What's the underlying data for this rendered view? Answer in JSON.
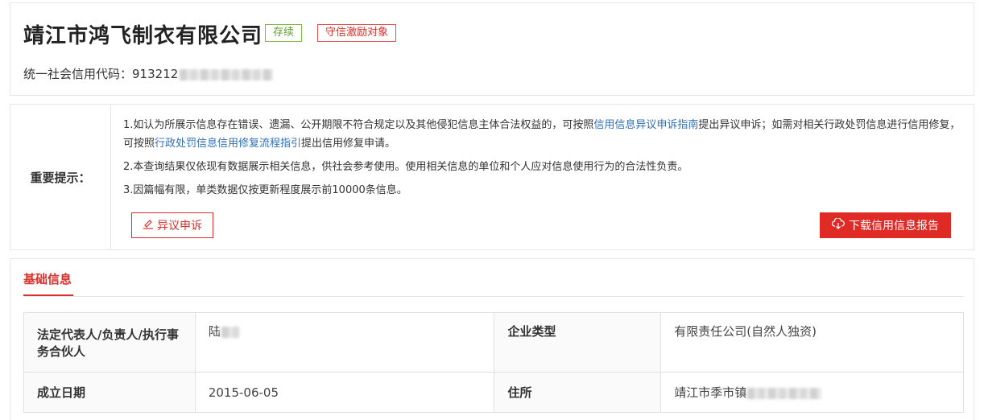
{
  "header": {
    "company_name": "靖江市鸿飞制衣有限公司",
    "status_badge": "存续",
    "honor_badge": "守信激励对象",
    "credit_code_label": "统一社会信用代码：",
    "credit_code_value": "913212"
  },
  "notice": {
    "label": "重要提示：",
    "line1_part1": "1.如认为所展示信息存在错误、遗漏、公开期限不符合规定以及其他侵犯信息主体合法权益的，可按照",
    "line1_link1": "信用信息异议申诉指南",
    "line1_part2": "提出异议申诉；如需对相关行政处罚信息进行信用修复，可按照",
    "line1_link2": "行政处罚信息信用修复流程指引",
    "line1_part3": "提出信用修复申请。",
    "line2": "2.本查询结果仅依现有数据展示相关信息，供社会参考使用。使用相关信息的单位和个人应对信息使用行为的合法性负责。",
    "line3": "3.因篇幅有限，单类数据仅按更新程度展示前10000条信息。",
    "objection_button": "异议申诉",
    "download_button": "下载信用信息报告"
  },
  "basic_info": {
    "tab_label": "基础信息",
    "rows": [
      {
        "key1": "法定代表人/负责人/执行事务合伙人",
        "val1": "陆",
        "key2": "企业类型",
        "val2": "有限责任公司(自然人独资)"
      },
      {
        "key1": "成立日期",
        "val1": "2015-06-05",
        "key2": "住所",
        "val2": "靖江市季市镇"
      }
    ]
  },
  "colors": {
    "accent_red": "#d9302b",
    "download_red": "#e02a26",
    "status_green": "#5f9f2f",
    "link_blue": "#2f6fb8"
  },
  "icons": {
    "objection": "pen-edit-icon",
    "download": "cloud-download-icon"
  }
}
